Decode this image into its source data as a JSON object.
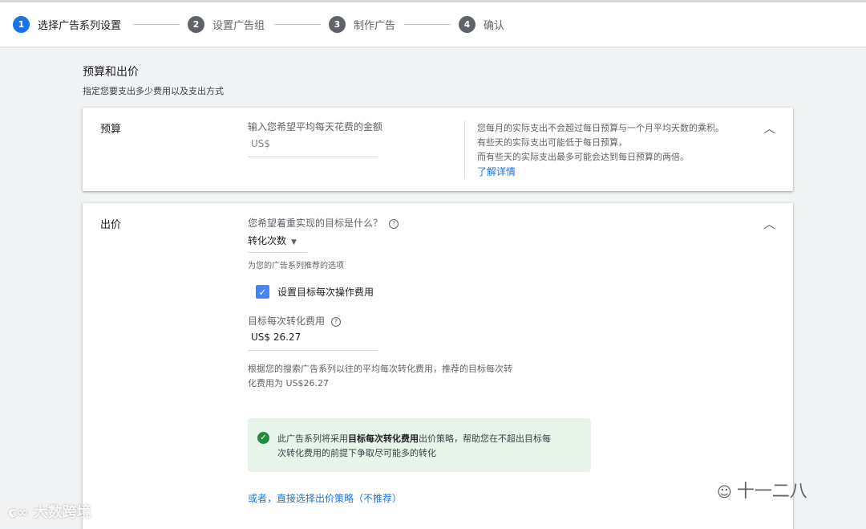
{
  "stepper": {
    "steps": [
      {
        "num": "1",
        "label": "选择广告系列设置"
      },
      {
        "num": "2",
        "label": "设置广告组"
      },
      {
        "num": "3",
        "label": "制作广告"
      },
      {
        "num": "4",
        "label": "确认"
      }
    ]
  },
  "section": {
    "title": "预算和出价",
    "subtitle": "指定您要支出多少费用以及支出方式"
  },
  "budget": {
    "label": "预算",
    "field_label": "输入您希望平均每天花费的金额",
    "currency_placeholder": "US$",
    "info_lines": [
      "您每月的实际支出不会超过每日预算与一个月平均天数的乘积。",
      "有些天的实际支出可能低于每日预算，",
      "而有些天的实际支出最多可能会达到每日预算的两倍。"
    ],
    "learn_more": "了解详情"
  },
  "bidding": {
    "label": "出价",
    "question": "您希望着重实现的目标是什么？",
    "help_icon": "?",
    "selected_goal": "转化次数",
    "recommended_note": "为您的广告系列推荐的选项",
    "checkbox_label": "设置目标每次操作费用",
    "checkbox_checked": true,
    "target_cpa_label": "目标每次转化费用",
    "target_cpa_value": "US$ 26.27",
    "recommendation_lines": [
      "根据您的搜索广告系列以往的平均每次转化费用，推荐的目标每次转",
      "化费用为 US$26.27"
    ],
    "success": {
      "line1_pre": "此广告系列将采用",
      "line1_bold": "目标每次转化费用",
      "line1_post": "出价策略，帮助您在不超出目标每",
      "line2": "次转化费用的前提下争取尽可能多的转化"
    },
    "alt_link": "或者，直接选择出价策略（不推荐）"
  },
  "watermarks": {
    "left": "大数跨境",
    "right": "十一二八"
  },
  "colors": {
    "accent": "#1a73e8",
    "success_bg": "#e6f4ea",
    "success_icon": "#1e8e3e",
    "checkbox": "#4285f4"
  }
}
